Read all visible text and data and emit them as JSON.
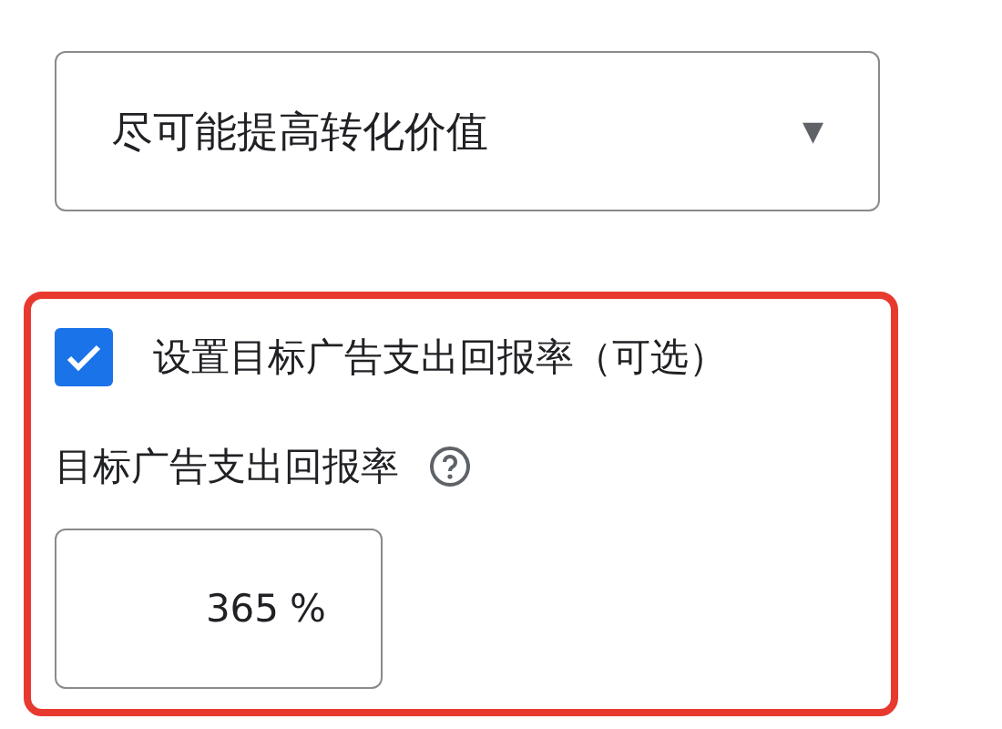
{
  "bid_strategy": {
    "value": "尽可能提高转化价值",
    "caret": "▼"
  },
  "roas_section": {
    "checkbox": {
      "label": "设置目标广告支出回报率（可选）",
      "checked": true
    },
    "field_label": "目标广告支出回报率",
    "field": {
      "value": "365",
      "suffix": "%"
    }
  }
}
